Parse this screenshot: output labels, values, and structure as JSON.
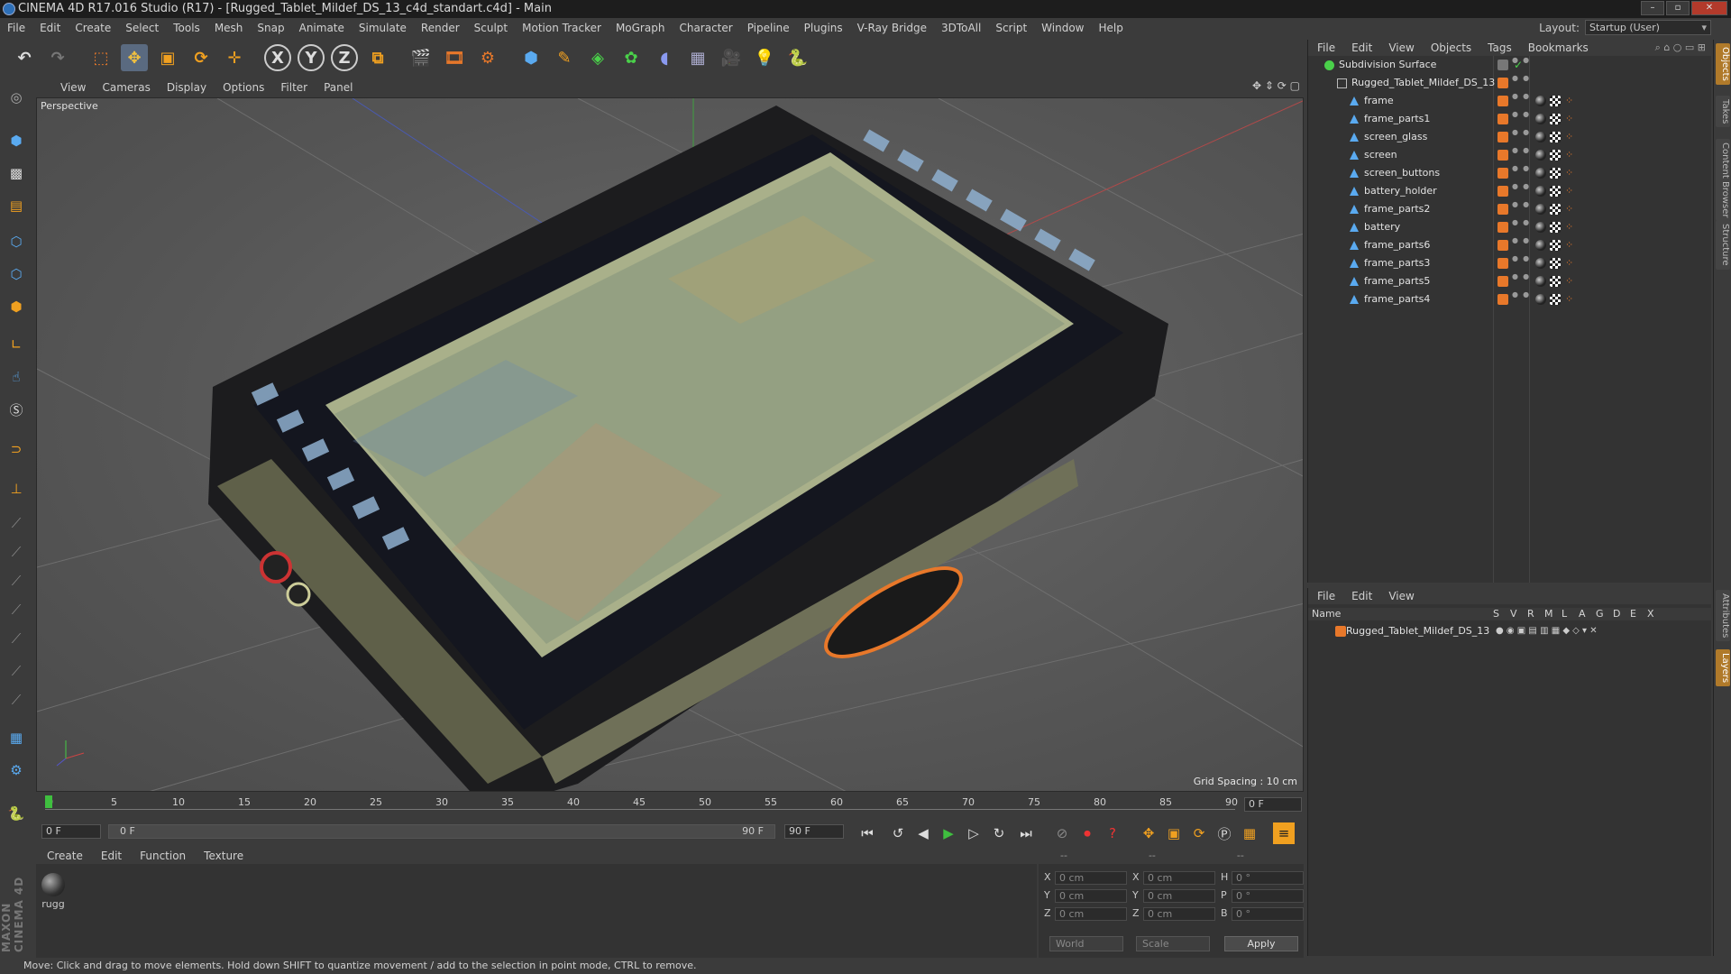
{
  "window": {
    "title": "CINEMA 4D R17.016 Studio (R17) - [Rugged_Tablet_Mildef_DS_13_c4d_standart.c4d] - Main"
  },
  "menu": [
    "File",
    "Edit",
    "Create",
    "Select",
    "Tools",
    "Mesh",
    "Snap",
    "Animate",
    "Simulate",
    "Render",
    "Sculpt",
    "Motion Tracker",
    "MoGraph",
    "Character",
    "Pipeline",
    "Plugins",
    "V-Ray Bridge",
    "3DToAll",
    "Script",
    "Window",
    "Help"
  ],
  "layout": {
    "label": "Layout:",
    "value": "Startup (User)"
  },
  "toolbar": {
    "x_label": "X",
    "y_label": "Y",
    "z_label": "Z"
  },
  "viewport_menu": [
    "View",
    "Cameras",
    "Display",
    "Options",
    "Filter",
    "Panel"
  ],
  "viewport": {
    "label": "Perspective",
    "grid_spacing": "Grid Spacing : 10 cm"
  },
  "timeline": {
    "ticks": [
      "0",
      "5",
      "10",
      "15",
      "20",
      "25",
      "30",
      "35",
      "40",
      "45",
      "50",
      "55",
      "60",
      "65",
      "70",
      "75",
      "80",
      "85",
      "90"
    ],
    "current_frame": "0 F",
    "start": "0 F",
    "range_start": "0 F",
    "range_end": "90 F",
    "end": "90 F"
  },
  "material_menu": [
    "Create",
    "Edit",
    "Function",
    "Texture"
  ],
  "materials": [
    {
      "name": "rugg"
    }
  ],
  "coords": {
    "header": [
      "--",
      "--",
      "--"
    ],
    "rows": [
      {
        "a": "X",
        "v1": "0 cm",
        "b": "X",
        "v2": "0 cm",
        "c": "H",
        "v3": "0 °"
      },
      {
        "a": "Y",
        "v1": "0 cm",
        "b": "Y",
        "v2": "0 cm",
        "c": "P",
        "v3": "0 °"
      },
      {
        "a": "Z",
        "v1": "0 cm",
        "b": "Z",
        "v2": "0 cm",
        "c": "B",
        "v3": "0 °"
      }
    ],
    "space": "World",
    "mode": "Scale",
    "apply": "Apply"
  },
  "status": "Move: Click and drag to move elements. Hold down SHIFT to quantize movement / add to the selection in point mode, CTRL to remove.",
  "branding": "MAXON CINEMA 4D",
  "object_menu": [
    "File",
    "Edit",
    "View",
    "Objects",
    "Tags",
    "Bookmarks"
  ],
  "objects": [
    {
      "name": "Subdivision Surface",
      "level": 0
    },
    {
      "name": "Rugged_Tablet_Mildef_DS_13",
      "level": 1
    },
    {
      "name": "frame",
      "level": 2
    },
    {
      "name": "frame_parts1",
      "level": 2
    },
    {
      "name": "screen_glass",
      "level": 2
    },
    {
      "name": "screen",
      "level": 2
    },
    {
      "name": "screen_buttons",
      "level": 2
    },
    {
      "name": "battery_holder",
      "level": 2
    },
    {
      "name": "frame_parts2",
      "level": 2
    },
    {
      "name": "battery",
      "level": 2
    },
    {
      "name": "frame_parts6",
      "level": 2
    },
    {
      "name": "frame_parts3",
      "level": 2
    },
    {
      "name": "frame_parts5",
      "level": 2
    },
    {
      "name": "frame_parts4",
      "level": 2
    }
  ],
  "layer_menu": [
    "File",
    "Edit",
    "View"
  ],
  "layer_header": {
    "name": "Name",
    "cols": [
      "S",
      "V",
      "R",
      "M",
      "L",
      "A",
      "G",
      "D",
      "E",
      "X"
    ]
  },
  "layers": [
    {
      "name": "Rugged_Tablet_Mildef_DS_13"
    }
  ],
  "right_tabs": [
    "Objects",
    "Takes",
    "Content Browser",
    "Structure",
    "Attributes",
    "Layers"
  ],
  "colors": {
    "accent": "#e8782a",
    "bg": "#3b3b3b",
    "panel": "#333333"
  }
}
